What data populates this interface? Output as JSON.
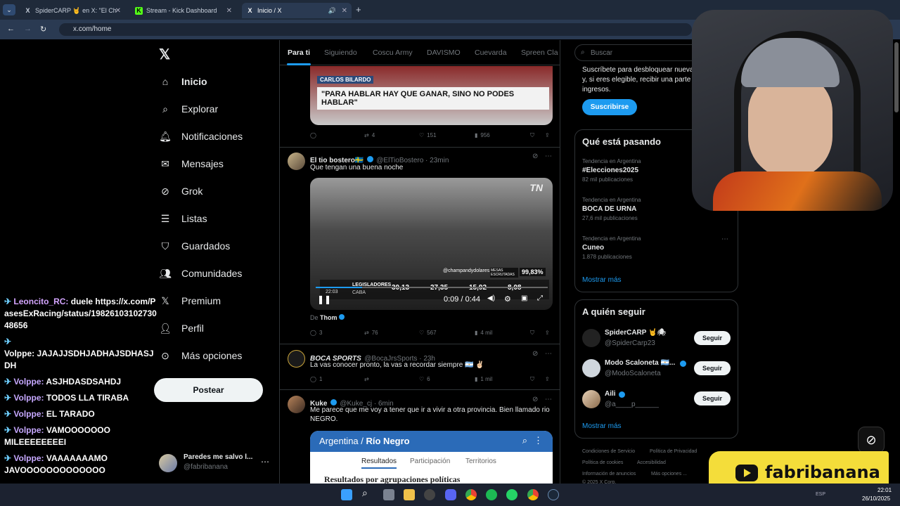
{
  "browser": {
    "tabs": [
      {
        "label": "SpiderCARP 🤘 en X: \"El Ch",
        "icon": "X"
      },
      {
        "label": "Stream - Kick Dashboard",
        "icon": "K"
      },
      {
        "label": "Inicio / X",
        "icon": "X"
      }
    ],
    "url": "x.com/home"
  },
  "sidebar": {
    "items": [
      {
        "label": "Inicio",
        "icon": "home-icon"
      },
      {
        "label": "Explorar",
        "icon": "search-icon"
      },
      {
        "label": "Notificaciones",
        "icon": "bell-icon"
      },
      {
        "label": "Mensajes",
        "icon": "mail-icon"
      },
      {
        "label": "Grok",
        "icon": "grok-icon"
      },
      {
        "label": "Listas",
        "icon": "list-icon"
      },
      {
        "label": "Guardados",
        "icon": "bookmark-icon"
      },
      {
        "label": "Comunidades",
        "icon": "people-icon"
      },
      {
        "label": "Premium",
        "icon": "x-icon"
      },
      {
        "label": "Perfil",
        "icon": "person-icon"
      },
      {
        "label": "Más opciones",
        "icon": "more-icon"
      }
    ],
    "post_label": "Postear",
    "account": {
      "name": "Paredes me salvo l...",
      "handle": "@fabribanana"
    }
  },
  "chat": [
    {
      "user": "Leoncito_RC:",
      "text": "duele https://x.com/PasesExRacing/status/1982610310273048656"
    },
    {
      "user": "",
      "text": "Volppe: JAJAJJSDHJADHAJSDHASJDH"
    },
    {
      "user": "Volppe:",
      "text": "ASJHDASDSAHDJ"
    },
    {
      "user": "Volppe:",
      "text": "TODOS LLA TIRABA"
    },
    {
      "user": "Volppe:",
      "text": "EL TARADO"
    },
    {
      "user": "Volppe:",
      "text": "VAMOOOOOOO MILEEEEEEEEI"
    },
    {
      "user": "Volppe:",
      "text": "VAAAAAAAMO JAVOOOOOOOOOOOOO"
    }
  ],
  "feed": {
    "tabs": [
      "Para ti",
      "Siguiendo",
      "Coscu Army",
      "DAVISMO",
      "Cuevarda",
      "Spreen Cla"
    ],
    "tweets": [
      {
        "caption_top": "CARLOS BILARDO",
        "caption": "\"PARA HABLAR HAY QUE GANAR, SINO NO PODES HABLAR\"",
        "replies": "",
        "retweets": "4",
        "likes": "151",
        "views": "956"
      },
      {
        "name": "El tio bostero🇸🇪",
        "handle": "@ElTioBostero · 23min",
        "text": "Que tengan una buena noche",
        "video_time": "0:09 / 0:44",
        "from": "De",
        "from_name": "Thom",
        "replies": "3",
        "retweets": "76",
        "likes": "567",
        "views": "4 mil",
        "overlay": {
          "handle": "@champandydolares",
          "mesas": "MESAS ESCRUTADAS",
          "pct": "99,83%",
          "label": "LEGISLADORES",
          "region": "CABA",
          "clock": "22:03",
          "v1": "30,13",
          "v2": "27,35",
          "v3": "15,92",
          "v4": "8,08",
          "logo": "TN"
        }
      },
      {
        "name": "BOCA SPORTS",
        "handle": "@BocaJrsSports · 23h",
        "text": "La vas conocer pronto, la vas a recordar siempre 🇦🇷 ✌🏻",
        "replies": "1",
        "retweets": "",
        "likes": "6",
        "views": "1 mil"
      },
      {
        "name": "Kuke",
        "handle": "@Kuke_cj · 6min",
        "text": "Me parece que me voy a tener que ir a vivir a otra provincia. Bien llamado rio NEGRO.",
        "card": {
          "region": "Argentina",
          "sub": "Río Negro",
          "tabs": [
            "Resultados",
            "Participación",
            "Territorios"
          ],
          "heading": "Resultados por agrupaciones políticas"
        }
      }
    ]
  },
  "right": {
    "search_placeholder": "Buscar",
    "premium_text": "Suscríbete para desbloquear nuevas funciones y, si eres elegible, recibir una parte de cuota de ingresos.",
    "subscribe_label": "Suscribirse",
    "trends_title": "Qué está pasando",
    "trends": [
      {
        "context": "Tendencia en Argentina",
        "name": "#Elecciones2025",
        "count": "82 mil publicaciones"
      },
      {
        "context": "Tendencia en Argentina",
        "name": "BOCA DE URNA",
        "count": "27,6 mil publicaciones"
      },
      {
        "context": "Tendencia en Argentina",
        "name": "Cuneo",
        "count": "1.878 publicaciones"
      }
    ],
    "show_more": "Mostrar más",
    "follow_title": "A quién seguir",
    "follow": [
      {
        "name": "SpiderCARP 🤘🕷",
        "handle": "@SpiderCarp23"
      },
      {
        "name": "Modo Scaloneta 🇦🇷...",
        "handle": "@ModoScaloneta"
      },
      {
        "name": "Aili",
        "handle": "@a____p______"
      }
    ],
    "follow_label": "Seguir",
    "footer": [
      "Condiciones de Servicio",
      "Política de Privacidad",
      "Política de cookies",
      "Accesibilidad",
      "Información de anuncios",
      "Más opciones ...",
      "© 2025 X Corp."
    ]
  },
  "overlay_yt": "fabribanana",
  "taskbar": {
    "time": "22:01",
    "date": "26/10/2025",
    "lang": "ESP"
  }
}
